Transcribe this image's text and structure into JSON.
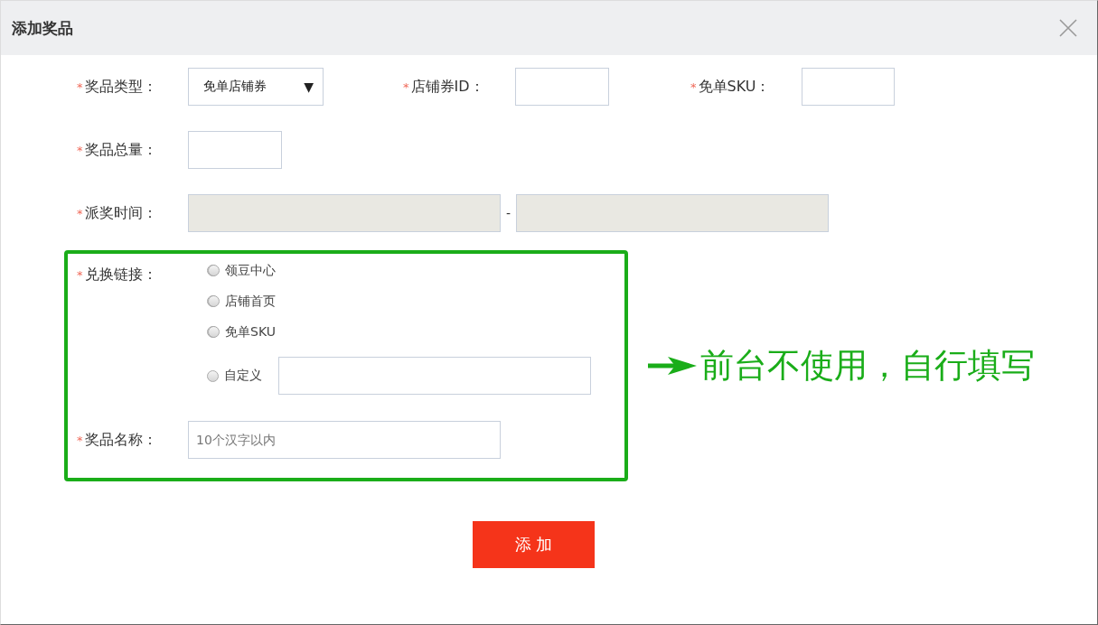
{
  "dialog": {
    "title": "添加奖品"
  },
  "row_1": [
    {
      "asterisk": "*",
      "label": "奖品类型：",
      "kind": "select",
      "value": "免单店铺券",
      "caret": "▼"
    },
    {
      "asterisk": "*",
      "label": "店铺券ID：",
      "kind": "input"
    },
    {
      "asterisk": "*",
      "label": "免单SKU：",
      "kind": "input"
    }
  ],
  "prize_total": {
    "asterisk": "*",
    "label": "奖品总量："
  },
  "dispatch_time": {
    "asterisk": "*",
    "label": "派奖时间：",
    "separator": "-",
    "disabled": true
  },
  "exchange_link": {
    "asterisk": "*",
    "label": "兑换链接：",
    "options": [
      {
        "label": "领豆中心",
        "selected": false,
        "kind": "radio"
      },
      {
        "label": "店铺首页",
        "selected": false,
        "kind": "radio"
      },
      {
        "label": "免单SKU",
        "selected": false,
        "kind": "radio"
      },
      {
        "label": "自定义",
        "selected": false,
        "kind": "radio_input"
      }
    ]
  },
  "prize_name": {
    "asterisk": "*",
    "label": "奖品名称：",
    "placeholder": "10个汉字以内"
  },
  "submit_button": "添 加",
  "annotation": {
    "text": "前台不使用，自行填写"
  }
}
